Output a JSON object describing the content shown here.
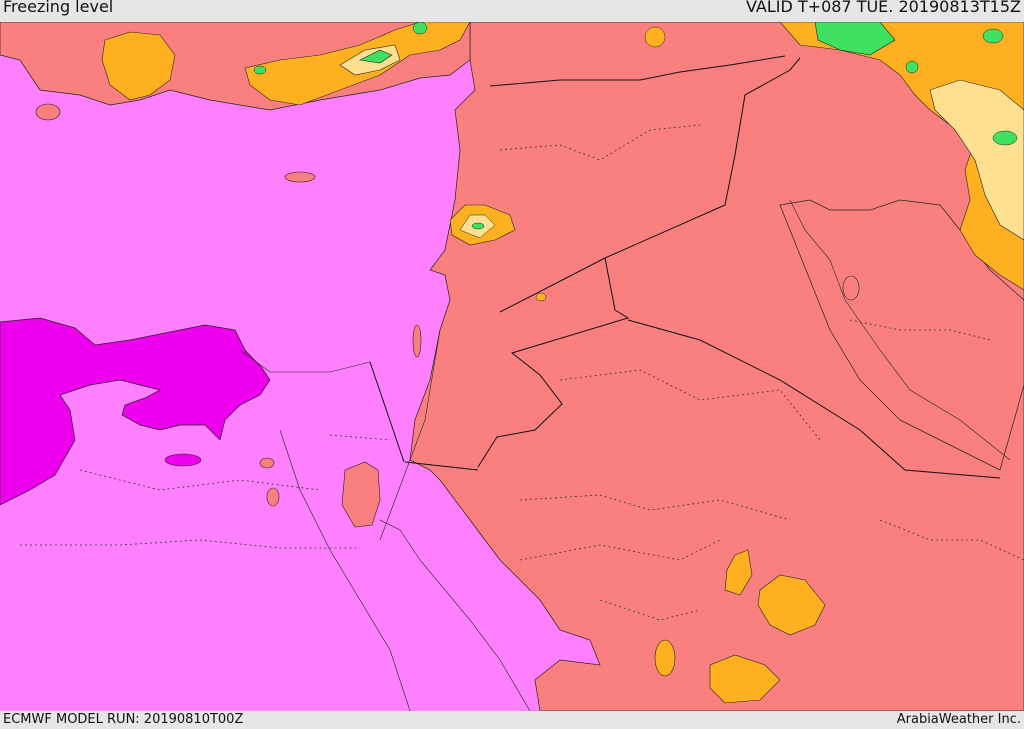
{
  "header": {
    "title": "Freezing level",
    "valid": "VALID T+087 TUE. 20190813T15Z"
  },
  "footer": {
    "model_run": "ECMWF MODEL RUN: 20190810T00Z",
    "credit": "ArabiaWeather Inc."
  },
  "colors": {
    "magenta_low": "#ff80ff",
    "magenta_deep": "#ee00ee",
    "salmon": "#fa8080",
    "orange": "#ffb020",
    "light_yellow": "#ffe090",
    "green": "#40e060"
  }
}
